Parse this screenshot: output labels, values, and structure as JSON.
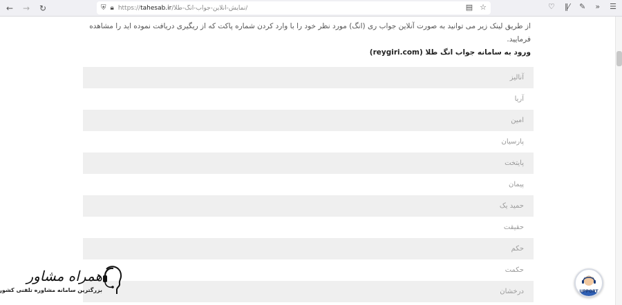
{
  "browser": {
    "url_prefix": "https://",
    "url_host": "tahesab.ir",
    "url_path": "/نمایش-آنلاین-جواب-انگ-طلا/",
    "icons": [
      "back-icon",
      "forward-icon",
      "reload-icon",
      "shield-icon",
      "lock-icon",
      "reader-icon",
      "bookmark-star-icon",
      "pocket-icon",
      "library-icon",
      "extensions-icon",
      "overflow-icon",
      "menu-icon"
    ]
  },
  "main": {
    "intro": "از طریق لینک زیر می توانید به صورت آنلاین جواب ری (انگ) مورد نظر خود را با وارد کردن شماره پاکت که از ریگیری دریافت نموده اید را مشاهده فرمایید.",
    "section_title": "ورود به سامانه جواب انگ طلا (reygiri.com)",
    "list_items": [
      "آنالیز",
      "آریا",
      "امین",
      "پارسیان",
      "پایتخت",
      "پیمان",
      "حمید یک",
      "حقیقت",
      "حکم",
      "حکمت",
      "درخشان"
    ]
  },
  "logo": {
    "title": "همراه مشاور",
    "subtitle": "بزرگترین سامانه مشاوره تلفنی کشور"
  },
  "support": {
    "label": "UPPORT"
  },
  "colors": {
    "toolbar_bg": "#f0f0f4",
    "row_shade": "#efefef",
    "support_blue": "#1d3c78"
  }
}
